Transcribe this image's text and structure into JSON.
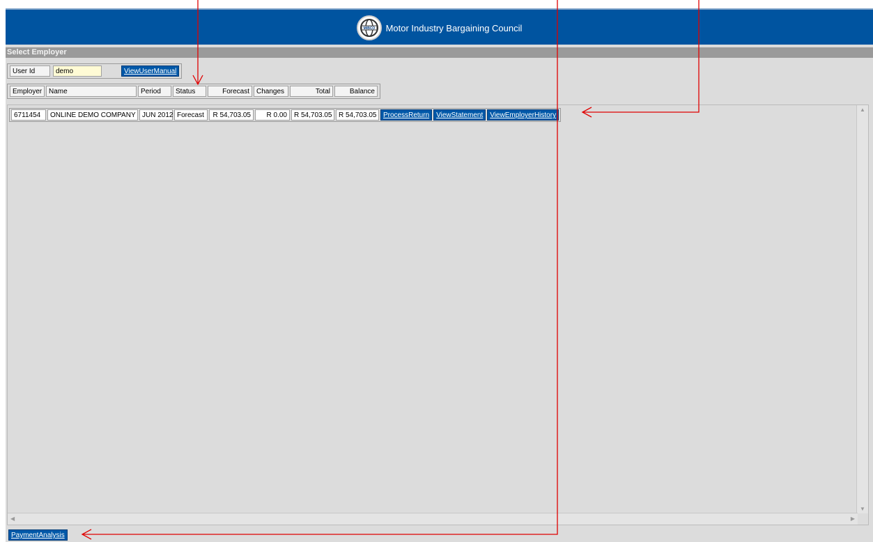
{
  "header": {
    "title": "Motor Industry Bargaining Council",
    "logo_text": "MIBCO"
  },
  "section_title": "Select Employer",
  "user": {
    "label": "User Id",
    "value": "demo",
    "manual_link": "ViewUserManual"
  },
  "columns": [
    "Employer",
    "Name",
    "Period",
    "Status",
    "Forecast",
    "Changes",
    "Total",
    "Balance"
  ],
  "rows": [
    {
      "employer": "6711454",
      "name": "ONLINE DEMO COMPANY",
      "period": "JUN 2012",
      "status": "Forecast",
      "forecast": "R 54,703.05",
      "changes": "R 0.00",
      "total": "R 54,703.05",
      "balance": "R 54,703.05",
      "actions": [
        "ProcessReturn",
        "ViewStatement",
        "ViewEmployerHistory"
      ]
    }
  ],
  "footer": {
    "link": "PaymentAnalysis"
  },
  "colors": {
    "header": "#0054a0",
    "link_bg": "#0058a8",
    "annotation": "#e00000",
    "input_bg": "#fffbd5"
  }
}
